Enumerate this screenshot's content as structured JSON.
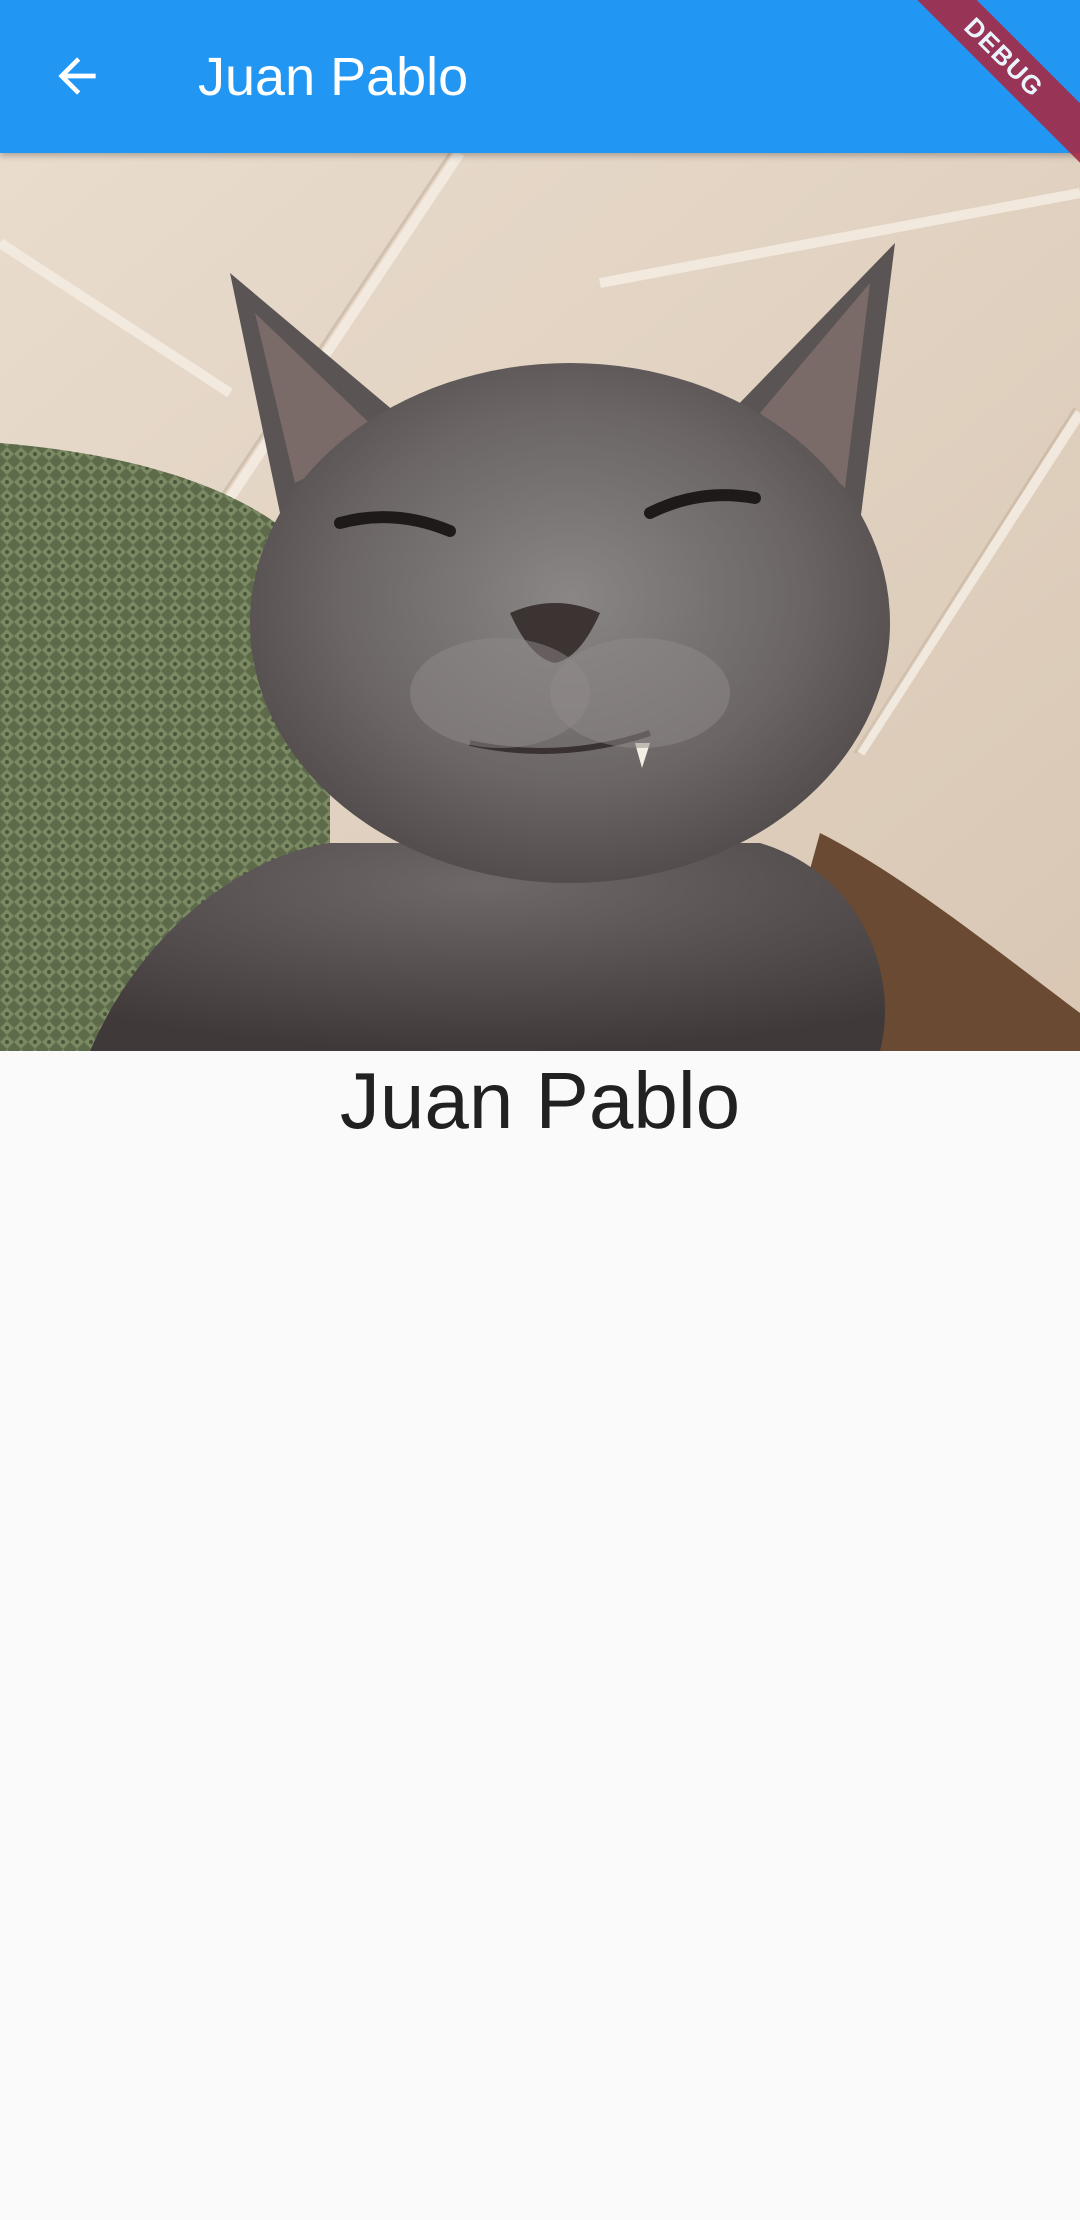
{
  "app_bar": {
    "title": "Juan Pablo",
    "back_icon": "arrow-back-icon",
    "background_color": "#2196f3",
    "title_color": "#ffffff"
  },
  "debug_banner": {
    "label": "DEBUG",
    "color": "#a52a45"
  },
  "profile": {
    "photo_subject": "gray cat photo",
    "name": "Juan Pablo"
  },
  "page": {
    "background_color": "#fafafa"
  }
}
